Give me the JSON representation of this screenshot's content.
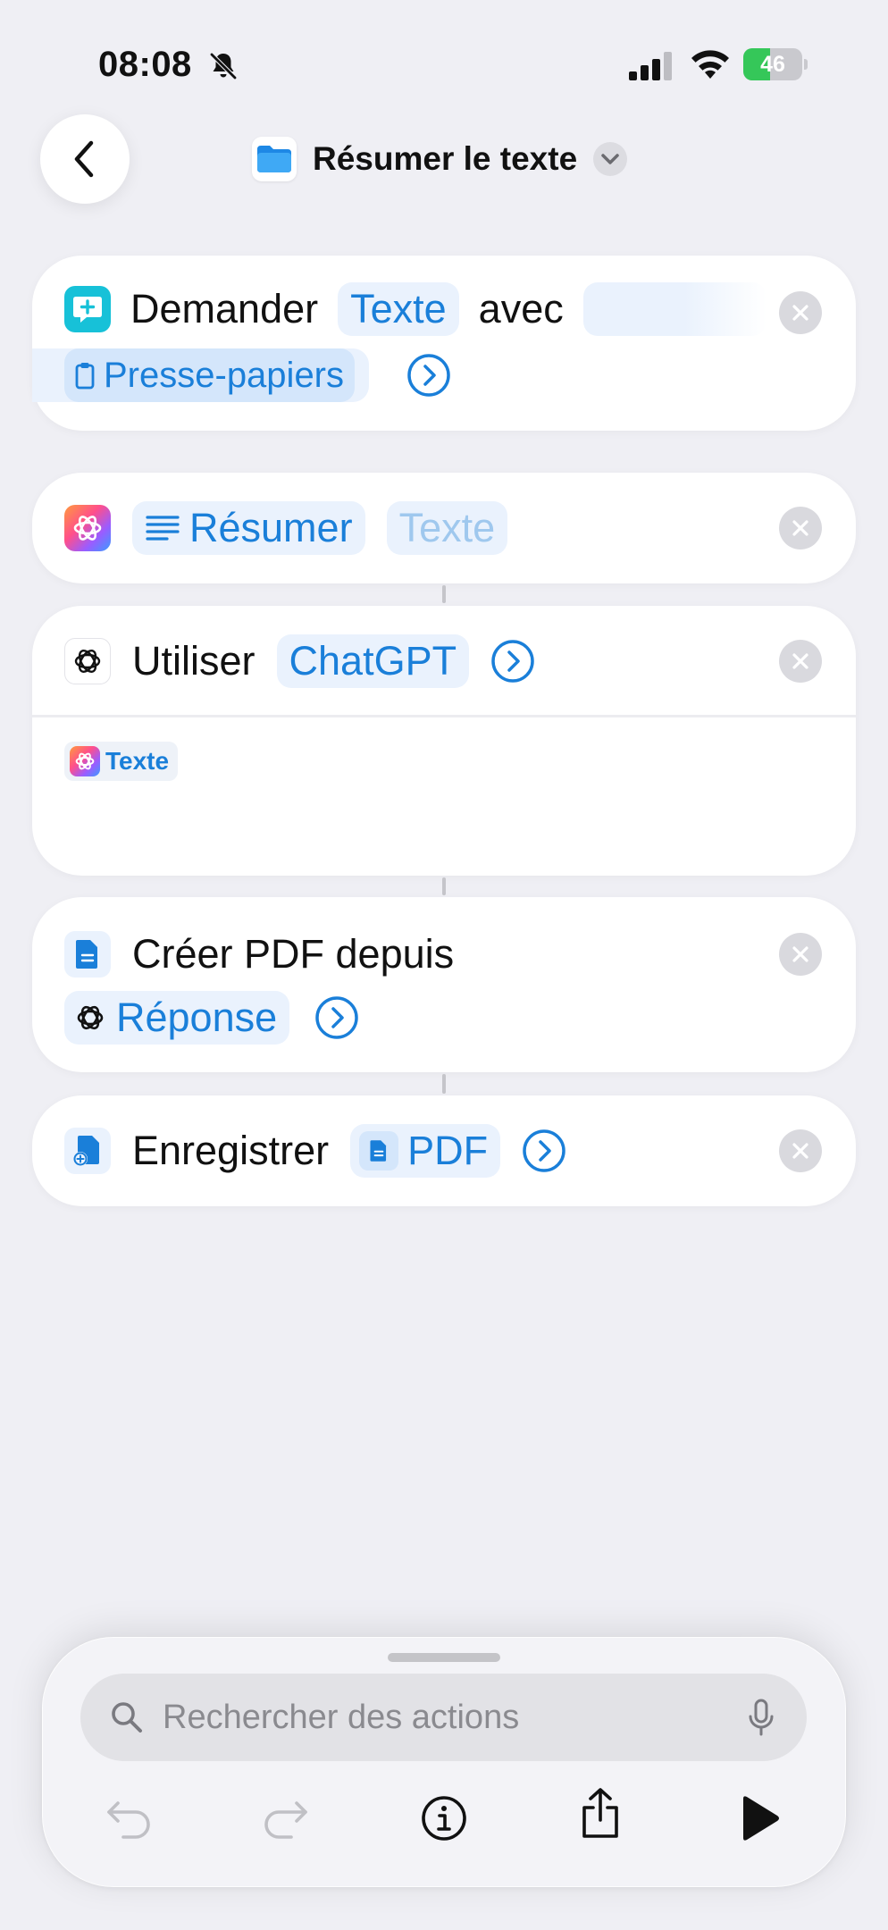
{
  "status_bar": {
    "time": "08:08",
    "battery_level": "46",
    "battery_fraction": 0.46,
    "icons": [
      "bell-slash-icon",
      "cellular-signal-icon",
      "wifi-icon",
      "battery-charging-icon"
    ]
  },
  "header": {
    "title": "Résumer le texte",
    "back_icon": "chevron-left-icon",
    "menu_icon": "chevron-down-icon",
    "shortcut_icon": "folder-icon"
  },
  "actions": [
    {
      "verb": "Demander",
      "param": "Texte",
      "connector": "avec",
      "default_value": "",
      "input": "Presse-papiers",
      "icon": "ask-input-icon"
    },
    {
      "verb": "Résumer",
      "param": "Texte",
      "icon": "apple-intelligence-icon"
    },
    {
      "verb": "Utiliser",
      "param": "ChatGPT",
      "input_token": "Texte",
      "icon": "chatgpt-icon"
    },
    {
      "verb": "Créer PDF depuis",
      "param": "Réponse",
      "icon": "document-icon"
    },
    {
      "verb": "Enregistrer",
      "param": "PDF",
      "icon": "save-document-icon"
    }
  ],
  "bottom_panel": {
    "search_placeholder": "Rechercher des actions",
    "search_value": "",
    "toolbar_icons": [
      "undo-icon",
      "redo-icon",
      "info-icon",
      "share-icon",
      "play-icon"
    ]
  },
  "colors": {
    "accent": "#1a7fd9",
    "chip_bg": "#eaf2fd",
    "background": "#efeff4",
    "battery_green": "#35c759"
  }
}
